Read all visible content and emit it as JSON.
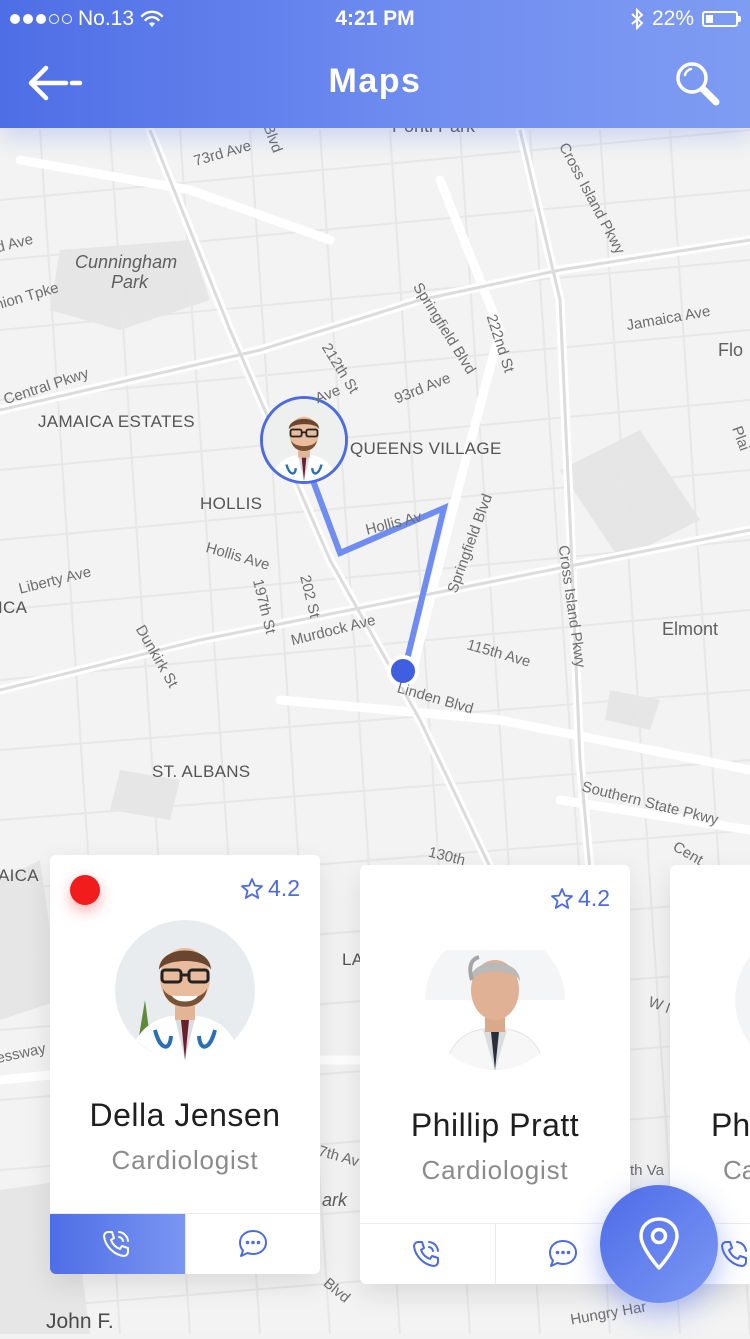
{
  "status_bar": {
    "carrier": "No.13",
    "time": "4:21 PM",
    "battery": "22%"
  },
  "header": {
    "title": "Maps"
  },
  "map": {
    "labels": {
      "ave73": "73rd Ave",
      "blvd_top": "Blvd",
      "ponti_park": "Ponti Park",
      "cross_island_top": "Cross Island Pkwy",
      "ave_left": "d Ave",
      "cunningham": "Cunningham",
      "park": "Park",
      "union_tpke": "nion Tpke",
      "springfield_top": "Springfield Blvd",
      "st222": "222nd St",
      "jamaica_ave": "Jamaica Ave",
      "flo": "Flo",
      "central_pkwy": "Central Pkwy",
      "st212": "212th St",
      "ave93": "93rd Ave",
      "ave_small": "Ave",
      "jamaica_estates": "JAMAICA ESTATES",
      "queens_village": "QUEENS VILLAGE",
      "plai": "Plai",
      "hollis": "HOLLIS",
      "hollis_av": "Hollis Av",
      "springfield_blvd": "Springfield Blvd",
      "hollis_ave": "Hollis Ave",
      "liberty_ave": "Liberty Ave",
      "ica": "ICA",
      "st197": "197th St",
      "st202": "202 St",
      "dunkirk": "Dunkirk St",
      "murdock_ave": "Murdock Ave",
      "cross_island_mid": "Cross Island Pkwy",
      "elmont": "Elmont",
      "ave115": "115th Ave",
      "linden_blvd": "Linden Blvd",
      "st_albans": "ST. ALBANS",
      "southern_state": "Southern State Pkwy",
      "cent": "Cent",
      "ave130": "130th",
      "aica": "AICA",
      "la": "LA",
      "w_n": "W N",
      "essway": "essway",
      "th_av": "7th Av",
      "ark": "ark",
      "th_va": "th Va",
      "blvd_bottom": "Blvd",
      "hungry_har": "Hungry Har",
      "john_f": "John F."
    }
  },
  "doctors": [
    {
      "name": "Della Jensen",
      "specialty": "Cardiologist",
      "rating": "4.2",
      "online": true
    },
    {
      "name": "Phillip Pratt",
      "specialty": "Cardiologist",
      "rating": "4.2",
      "online": false
    },
    {
      "name": "Ph",
      "specialty": "Ca",
      "rating": "",
      "online": false
    }
  ],
  "icons": {
    "back": "arrow-left-icon",
    "search": "search-icon",
    "call": "phone-call-icon",
    "chat": "chat-bubble-icon",
    "rating": "star-outline-icon",
    "fab": "location-pin-icon"
  },
  "colors": {
    "primary": "#4e6ee6",
    "primary_light": "#7f9cf3",
    "route": "#6f8cf0",
    "online": "#f21c1c"
  }
}
